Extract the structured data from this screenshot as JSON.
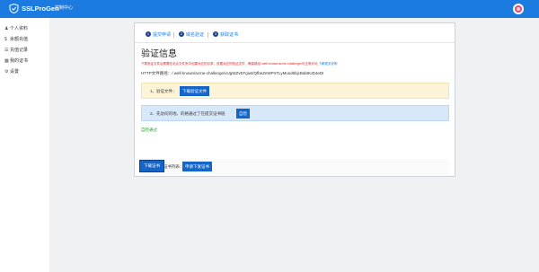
{
  "topbar": {
    "brand": "SSLProGen",
    "nav_link": "控制中心",
    "logo_icon": "shield-check-icon",
    "avatar_icon": "user-avatar-icon"
  },
  "sidebar": {
    "items": [
      {
        "icon": "user-icon",
        "label": "个人资料"
      },
      {
        "icon": "dollar-icon",
        "label": "余额充值"
      },
      {
        "icon": "list-icon",
        "label": "充值记录"
      },
      {
        "icon": "certificate-icon",
        "label": "我的证书"
      },
      {
        "icon": "gear-icon",
        "label": "设置"
      }
    ]
  },
  "steps": [
    {
      "num": "1",
      "label": "提交申请"
    },
    {
      "num": "2",
      "label": "域名验证"
    },
    {
      "num": "3",
      "label": "获取证书"
    }
  ],
  "main": {
    "title": "验证信息",
    "warning": "下载验证文件后需要在站点文件夹中创建对应的目录，放置对应的验证文件，确保路径/.well-known/acme-challenge/可正常访问",
    "warning_link": "了解更多说明",
    "http_file_path": "HTTP文件路径：/.well-known/acme-challenge/vUgWZvEFgiwt/QfbeZeWPnTLyMusd6bjcBab9UD4eDI",
    "step1_label": "1、验证文件：",
    "step1_button": "下载验证文件",
    "step2_label": "2、先访问的地，的格通过了在提交证书链",
    "step2_button": "自检",
    "status": "自检通过",
    "step3_label": "3、提交证书列表：",
    "step3_button": "申请下发证书",
    "download_button": "下载证书"
  }
}
